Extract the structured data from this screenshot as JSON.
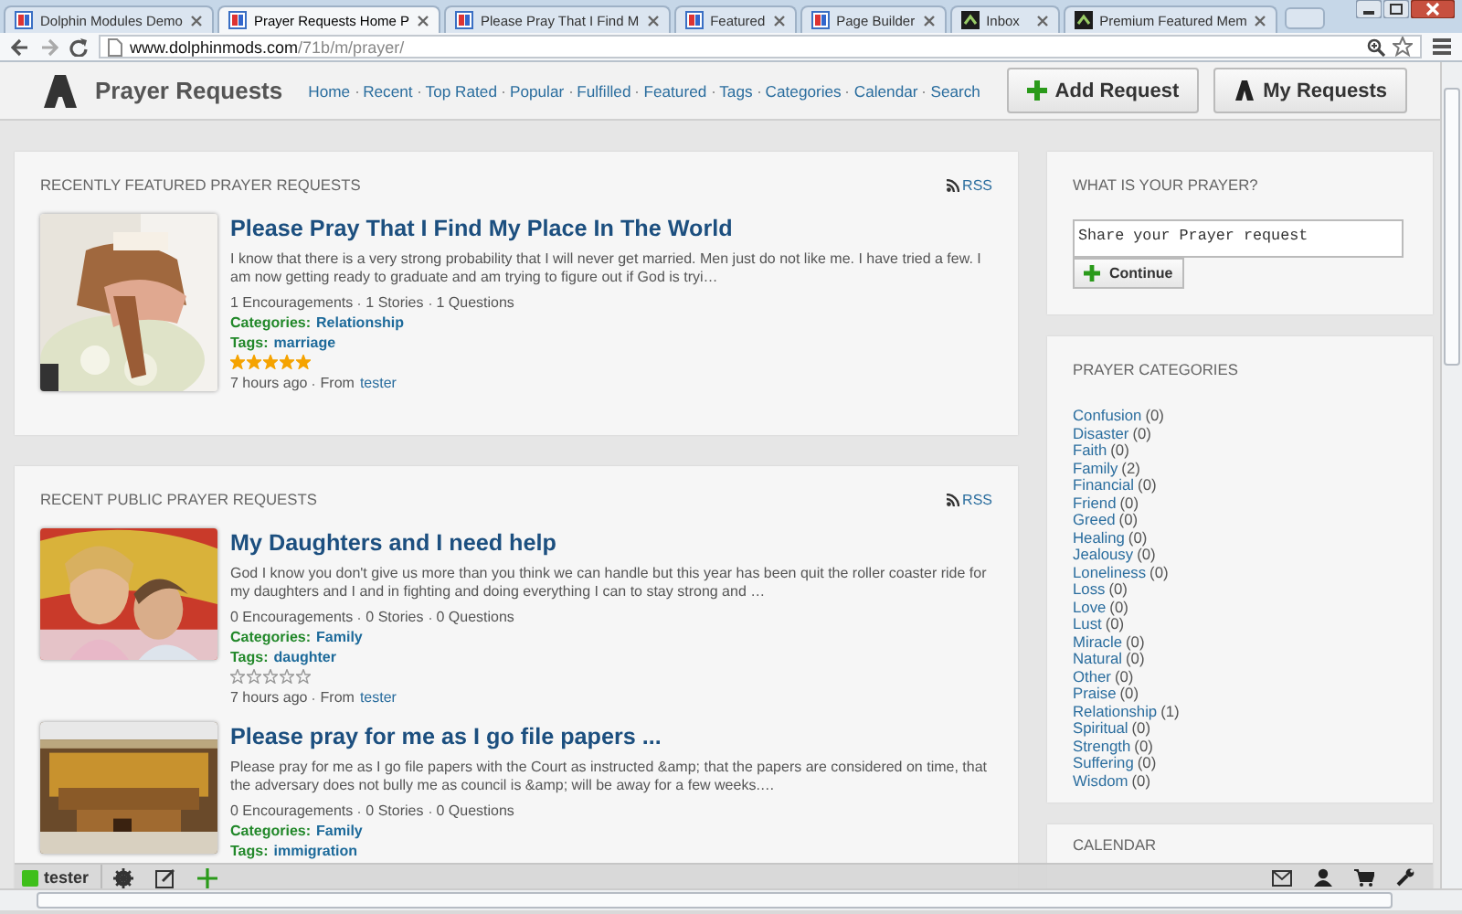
{
  "browser": {
    "tabs": [
      {
        "title": "Dolphin Modules Demo",
        "selected": false
      },
      {
        "title": "Prayer Requests Home P",
        "selected": true
      },
      {
        "title": "Please Pray That I Find M",
        "selected": false
      },
      {
        "title": "Featured",
        "selected": false
      },
      {
        "title": "Page Builder",
        "selected": false
      },
      {
        "title": "Inbox",
        "selected": false
      },
      {
        "title": "Premium Featured Mem",
        "selected": false
      }
    ],
    "url_domain": "www.dolphinmods.com",
    "url_path": "/71b/m/prayer/"
  },
  "header": {
    "title": "Prayer Requests",
    "nav": [
      "Home",
      "Recent",
      "Top Rated",
      "Popular",
      "Fulfilled",
      "Featured",
      "Tags",
      "Categories",
      "Calendar",
      "Search"
    ],
    "buttons": [
      {
        "label": "Add Request",
        "kind": "add"
      },
      {
        "label": "My Requests",
        "kind": "mine"
      }
    ]
  },
  "sections": [
    {
      "heading": "RECENTLY FEATURED PRAYER REQUESTS",
      "rss": "RSS",
      "items": [
        {
          "title": "Please Pray That I Find My Place In The World",
          "excerpt": "I know that there is a very strong probability that I will never get married. Men just do not like me. I have tried a few. I am now getting ready to graduate and am trying to figure out if God is tryi…",
          "stats": [
            "1 Encouragements",
            "1 Stories",
            "1 Questions"
          ],
          "categories_label": "Categories:",
          "category": "Relationship",
          "tags_label": "Tags:",
          "tag": "marriage",
          "stars": 5,
          "time": "7 hours ago",
          "from_label": "From",
          "author": "tester"
        }
      ]
    },
    {
      "heading": "RECENT PUBLIC PRAYER REQUESTS",
      "rss": "RSS",
      "items": [
        {
          "title": "My Daughters and I need help",
          "excerpt": "God I know you don't give us more than you think we can handle but this year has been quit the roller coaster ride for my daughters and I and in fighting and doing everything I can to stay strong and …",
          "stats": [
            "0 Encouragements",
            "0 Stories",
            "0 Questions"
          ],
          "categories_label": "Categories:",
          "category": "Family",
          "tags_label": "Tags:",
          "tag": "daughter",
          "stars": 0,
          "time": "7 hours ago",
          "from_label": "From",
          "author": "tester"
        },
        {
          "title": "Please pray for me as I go file papers ...",
          "excerpt": "Please pray for me as I go file papers with the Court as instructed &amp; that the papers are considered on time, that the adversary does not bully me as council is &amp; will be away for a few weeks.…",
          "stats": [
            "0 Encouragements",
            "0 Stories",
            "0 Questions"
          ],
          "categories_label": "Categories:",
          "category": "Family",
          "tags_label": "Tags:",
          "tag": "immigration"
        }
      ]
    }
  ],
  "prayer_box": {
    "heading": "WHAT IS YOUR PRAYER?",
    "placeholder": "Share your Prayer request",
    "button": "Continue"
  },
  "categories": {
    "heading": "PRAYER CATEGORIES",
    "items": [
      {
        "name": "Confusion",
        "count": "(0)"
      },
      {
        "name": "Disaster",
        "count": "(0)"
      },
      {
        "name": "Faith",
        "count": "(0)"
      },
      {
        "name": "Family",
        "count": "(2)"
      },
      {
        "name": "Financial",
        "count": "(0)"
      },
      {
        "name": "Friend",
        "count": "(0)"
      },
      {
        "name": "Greed",
        "count": "(0)"
      },
      {
        "name": "Healing",
        "count": "(0)"
      },
      {
        "name": "Jealousy",
        "count": "(0)"
      },
      {
        "name": "Loneliness",
        "count": "(0)"
      },
      {
        "name": "Loss",
        "count": "(0)"
      },
      {
        "name": "Love",
        "count": "(0)"
      },
      {
        "name": "Lust",
        "count": "(0)"
      },
      {
        "name": "Miracle",
        "count": "(0)"
      },
      {
        "name": "Natural",
        "count": "(0)"
      },
      {
        "name": "Other",
        "count": "(0)"
      },
      {
        "name": "Praise",
        "count": "(0)"
      },
      {
        "name": "Relationship",
        "count": "(1)"
      },
      {
        "name": "Spiritual",
        "count": "(0)"
      },
      {
        "name": "Strength",
        "count": "(0)"
      },
      {
        "name": "Suffering",
        "count": "(0)"
      },
      {
        "name": "Wisdom",
        "count": "(0)"
      }
    ]
  },
  "calendar": {
    "heading": "CALENDAR"
  },
  "toolbar": {
    "user": "tester"
  }
}
